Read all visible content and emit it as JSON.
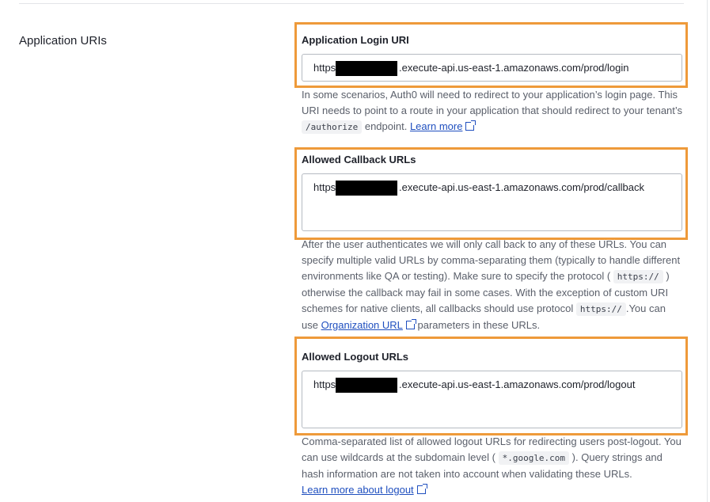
{
  "section": {
    "title": "Application URIs"
  },
  "login": {
    "label": "Application Login URI",
    "value_prefix": "https",
    "value_suffix": ".execute-api.us-east-1.amazonaws.com/prod/login",
    "help_before": "In some scenarios, Auth0 will need to redirect to your application’s login page. This URI needs to point to a route in your application that should redirect to your tenant’s ",
    "help_code": "/authorize",
    "help_after": " endpoint. ",
    "learn_more": "Learn more"
  },
  "callback": {
    "label": "Allowed Callback URLs",
    "value_prefix": "https",
    "value_suffix": ".execute-api.us-east-1.amazonaws.com/prod/callback",
    "help_1": "After the user authenticates we will only call back to any of these URLs. You can specify multiple valid URLs by comma-separating them (typically to handle different environments like QA or testing). Make sure to specify the protocol ( ",
    "help_code_1": "https://",
    "help_2": " ) otherwise the callback may fail in some cases. With the exception of custom URI schemes for native clients, all callbacks should use protocol ",
    "help_code_2": "https://",
    "help_3": ".You can use ",
    "org_link": "Organization URL",
    "help_4": " parameters in these URLs."
  },
  "logout": {
    "label": "Allowed Logout URLs",
    "value_prefix": "https",
    "value_suffix": ".execute-api.us-east-1.amazonaws.com/prod/logout",
    "help_1": "Comma-separated list of allowed logout URLs for redirecting users post-logout. You can use wildcards at the subdomain level ( ",
    "help_code": "*.google.com",
    "help_2": " ). Query strings and hash information are not taken into account when validating these URLs.",
    "learn_more": "Learn more about logout"
  },
  "colors": {
    "highlight": "#ee9a3a",
    "link": "#1f4fbf"
  }
}
